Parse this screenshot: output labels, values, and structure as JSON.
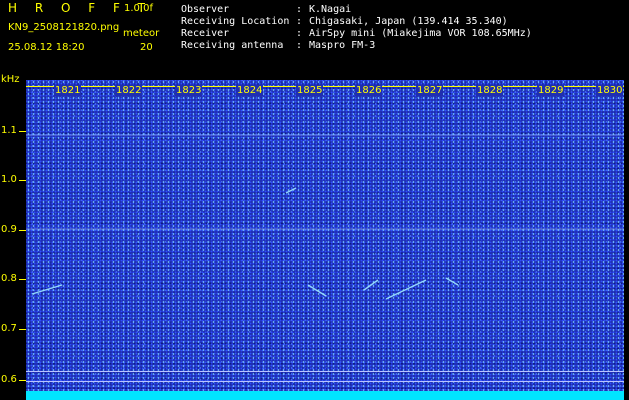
{
  "app": {
    "title": "H R O F F T",
    "version": "1.0.0f"
  },
  "file": {
    "name": "KN9_2508121820.png",
    "datetime": "25.08.12 18:20",
    "meteor_label": "meteor",
    "meteor_count": "20"
  },
  "info": [
    {
      "label": "Observer",
      "sep": ":",
      "value": "K.Nagai"
    },
    {
      "label": "Receiving Location",
      "sep": ":",
      "value": "Chigasaki, Japan (139.414 35.340)"
    },
    {
      "label": "Receiver",
      "sep": ":",
      "value": "AirSpy mini (Miakejima VOR 108.65MHz)"
    },
    {
      "label": "Receiving antenna",
      "sep": ":",
      "value": "Maspro FM-3"
    }
  ],
  "axis": {
    "unit": "kHz",
    "y_ticks": [
      "1.1",
      "1.0",
      "0.9",
      "0.8",
      "0.7",
      "0.6"
    ],
    "time_ticks": [
      "1821",
      "1822",
      "1823",
      "1824",
      "1825",
      "1826",
      "1827",
      "1828",
      "1829",
      "1830"
    ]
  },
  "colors": {
    "background": "#000000",
    "waterfall": "#1f2fb0",
    "label": "#ffff00",
    "band": "#00e5ff"
  }
}
